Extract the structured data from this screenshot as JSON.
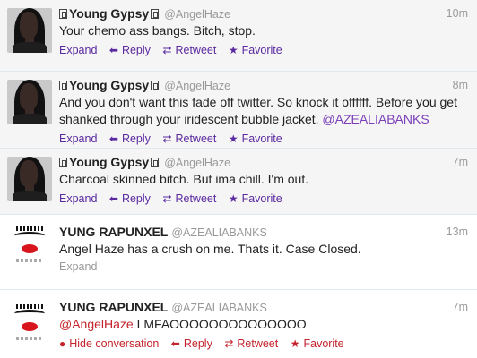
{
  "tweets": [
    {
      "display_name": "Young Gypsy",
      "handle": "@AngelHaze",
      "time": "10m",
      "text": "Your chemo ass bangs. Bitch, stop.",
      "actions": {
        "expand": "Expand",
        "reply": "Reply",
        "retweet": "Retweet",
        "favorite": "Favorite"
      }
    },
    {
      "display_name": "Young Gypsy",
      "handle": "@AngelHaze",
      "time": "8m",
      "text_before": "And you don't want this fade off twitter. So knock it offffff. Before you get shanked through your iridescent bubble jacket. ",
      "mention": "@AZEALIABANKS",
      "actions": {
        "expand": "Expand",
        "reply": "Reply",
        "retweet": "Retweet",
        "favorite": "Favorite"
      }
    },
    {
      "display_name": "Young Gypsy",
      "handle": "@AngelHaze",
      "time": "7m",
      "text": "Charcoal skinned bitch. But ima chill. I'm out.",
      "actions": {
        "expand": "Expand",
        "reply": "Reply",
        "retweet": "Retweet",
        "favorite": "Favorite"
      }
    },
    {
      "display_name": "YUNG RAPUNXEL",
      "handle": "@AZEALIABANKS",
      "time": "13m",
      "text": "Angel Haze has a crush on me. Thats it. Case Closed.",
      "actions": {
        "expand": "Expand"
      }
    },
    {
      "display_name": "YUNG RAPUNXEL",
      "handle": "@AZEALIABANKS",
      "time": "7m",
      "mention": "@AngelHaze",
      "text_after": " LMFAOOOOOOOOOOOOOO",
      "actions": {
        "hide": "Hide conversation",
        "reply": "Reply",
        "retweet": "Retweet",
        "favorite": "Favorite"
      }
    }
  ],
  "icons": {
    "reply": "reply-arrow",
    "retweet": "retweet-arrows",
    "favorite": "star",
    "hide": "speech-bubble",
    "verified": "verified-badge"
  },
  "colors": {
    "link": "#5b2aa0",
    "red_action": "#c4232c",
    "muted": "#999999",
    "highlight_bg": "#f5f5f5"
  }
}
